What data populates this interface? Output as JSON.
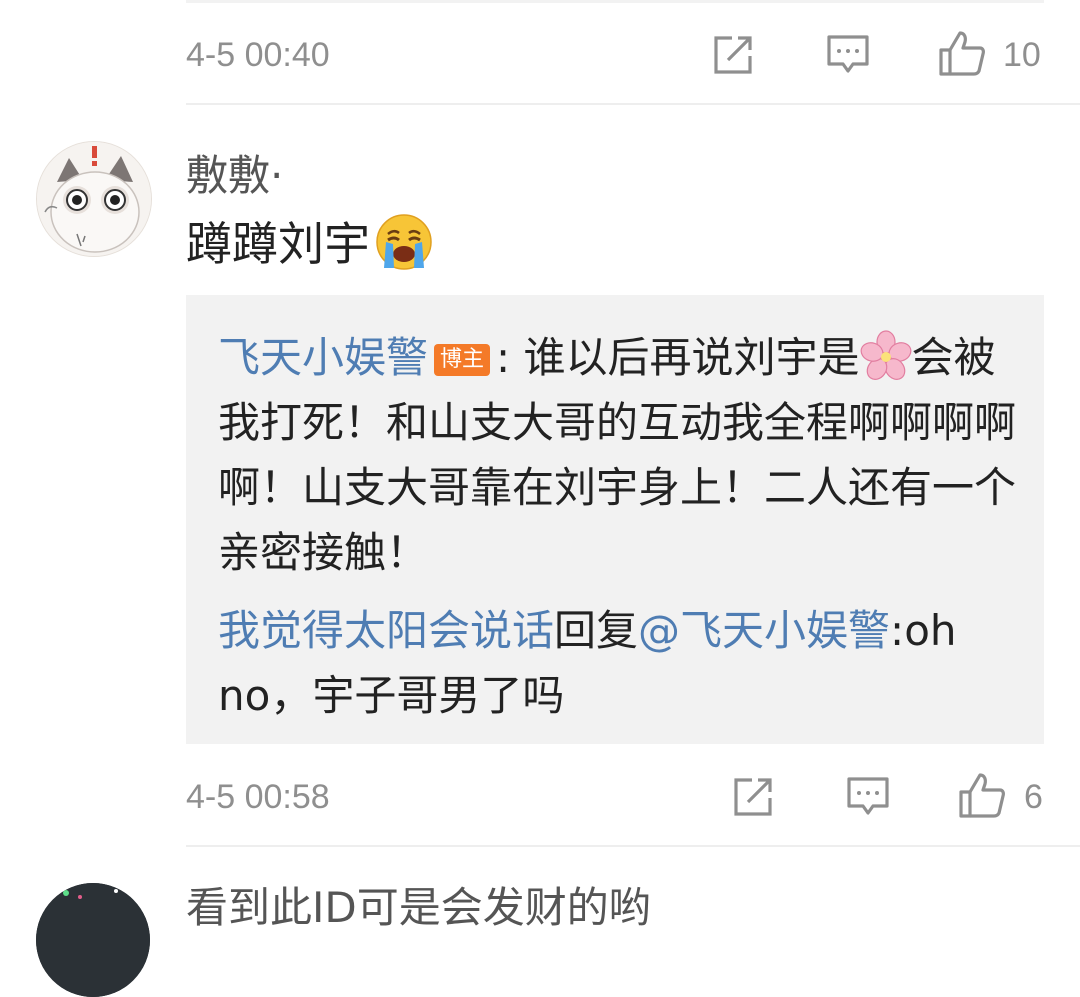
{
  "prev_comment": {
    "timestamp": "4-5 00:40",
    "like_count": "10"
  },
  "comment": {
    "username": "敷敷·",
    "text": "蹲蹲刘宇",
    "emoji_icon": "crying-face-icon",
    "reply_block": {
      "author": "飞天小娱警",
      "author_badge": "博主",
      "colon": ":",
      "text": " 谁以后再说刘宇是",
      "flower_icon": "cherry-blossom-icon",
      "text_cont": "会被我打死！和山支大哥的互动我全程啊啊啊啊啊！山支大哥靠在刘宇身上！二人还有一个亲密接触！",
      "reply_user": "我觉得太阳会说话",
      "reply_verb": "回复",
      "reply_target": "@飞天小娱警",
      "reply_text": ":oh no，宇子哥男了吗"
    },
    "timestamp": "4-5 00:58",
    "like_count": "6"
  },
  "next_comment": {
    "username": "看到此ID可是会发财的哟"
  },
  "colors": {
    "link_blue": "#4f7db3",
    "badge_orange": "#f47a28",
    "meta_gray": "#8f8f8f",
    "reply_bg": "#f2f2f2"
  }
}
